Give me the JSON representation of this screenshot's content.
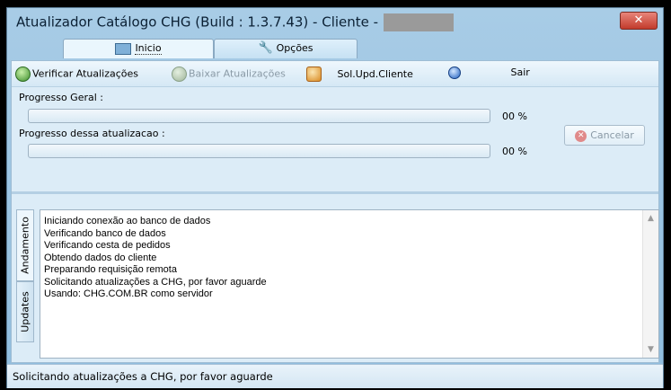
{
  "window": {
    "title": "Atualizador Catálogo CHG  (Build : 1.3.7.43) - Cliente -",
    "close_icon": "close-icon"
  },
  "tabs": [
    {
      "label": "Inicio",
      "icon": "home-icon",
      "active": true
    },
    {
      "label": "Opções",
      "icon": "wrench-icon",
      "active": false
    }
  ],
  "toolbar": {
    "verify_label": "Verificar Atualizações",
    "download_label": "Baixar Atualizações",
    "request_label": "Sol.Upd.Cliente",
    "exit_label": "Sair"
  },
  "progress": {
    "general_label": "Progresso Geral :",
    "general_value": "00 %",
    "current_label": "Progresso dessa atualizacao :",
    "current_value": "00 %",
    "cancel_label": "Cancelar"
  },
  "side_tabs": [
    {
      "label": "Andamento",
      "active": true
    },
    {
      "label": "Updates",
      "active": false
    }
  ],
  "log": [
    "Iniciando conexão ao banco de dados",
    "Verificando banco de dados",
    "Verificando cesta de pedidos",
    "Obtendo dados do cliente",
    "Preparando requisição remota",
    "Solicitando atualizações a CHG, por favor aguarde",
    "Usando: CHG.COM.BR como servidor"
  ],
  "status_text": "Solicitando atualizações a CHG, por favor aguarde",
  "colors": {
    "window_bg": "#a8cce6",
    "close": "#c23b2c"
  }
}
